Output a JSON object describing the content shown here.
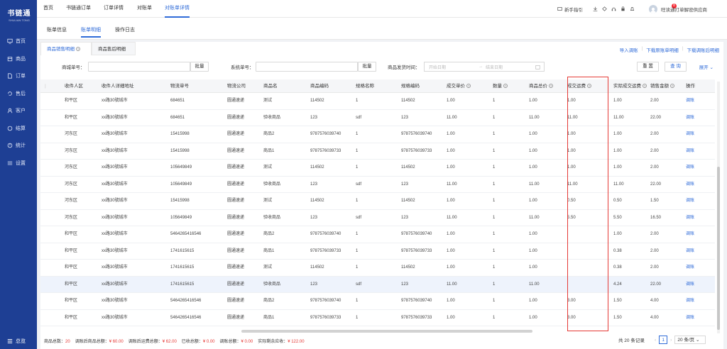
{
  "sidebar": {
    "logo_title": "书链通",
    "logo_sub": "SHULIAN TONG",
    "items": [
      {
        "label": "首页",
        "icon": "monitor-icon"
      },
      {
        "label": "商品",
        "icon": "box-icon"
      },
      {
        "label": "订单",
        "icon": "document-icon"
      },
      {
        "label": "售后",
        "icon": "aftersale-icon"
      },
      {
        "label": "客户",
        "icon": "user-icon"
      },
      {
        "label": "结算",
        "icon": "settlement-icon"
      },
      {
        "label": "统计",
        "icon": "chart-icon"
      },
      {
        "label": "设置",
        "icon": "settings-icon"
      }
    ],
    "bottom_label": "总览"
  },
  "topbar": {
    "tabs": [
      "首页",
      "书链通订单",
      "订单详情",
      "对账单",
      "对账单详情"
    ],
    "guide": "新手指引",
    "notification_count": "8",
    "user": "旺读通打单解密供应商"
  },
  "subtabs": [
    "账单信息",
    "账单明细",
    "操作日志"
  ],
  "panel": {
    "tabs": [
      "商品销售明细",
      "商品售后明细"
    ],
    "links": [
      "导入调账",
      "下载原账单明细",
      "下载调账后明细"
    ],
    "filters": {
      "order_label": "商城单号：",
      "batch": "批量",
      "system_label": "系统单号：",
      "ship_label": "商品发货时间：",
      "start_ph": "开始日期",
      "end_ph": "结束日期",
      "reset": "重 置",
      "query": "查 询",
      "expand": "展开"
    }
  },
  "table": {
    "columns": [
      "收件人区",
      "收件人详细地址",
      "物流单号",
      "物流公司",
      "商品名",
      "商品编码",
      "规格名称",
      "规格编码",
      "成交单价",
      "数量",
      "商品总价",
      "成交运费",
      "实际成交运费",
      "销售金额",
      "操作"
    ],
    "rows": [
      [
        "和平区",
        "xx路30號城市",
        "684651",
        "圆通速递",
        "测试",
        "114502",
        "1",
        "114502",
        "1.00",
        "1",
        "1.00",
        "1.00",
        "1.00",
        "2.00",
        "调账"
      ],
      [
        "和平区",
        "xx路30號城市",
        "684651",
        "圆通速递",
        "验收商品",
        "123",
        "sdf",
        "123",
        "11.00",
        "1",
        "11.00",
        "11.00",
        "11.00",
        "22.00",
        "调账"
      ],
      [
        "河东区",
        "xx路30號城市",
        "15415998",
        "圆通速递",
        "商品2",
        "9787576039740",
        "1",
        "9787576039740",
        "1.00",
        "1",
        "1.00",
        "1.00",
        "1.00",
        "2.00",
        "调账"
      ],
      [
        "河东区",
        "xx路30號城市",
        "15415998",
        "圆通速递",
        "商品1",
        "9787576039733",
        "1",
        "9787576039733",
        "1.00",
        "1",
        "1.00",
        "1.00",
        "1.00",
        "2.00",
        "调账"
      ],
      [
        "河东区",
        "xx路30號城市",
        "105649849",
        "圆通速递",
        "测试",
        "114502",
        "1",
        "114502",
        "1.00",
        "1",
        "1.00",
        "1.00",
        "1.00",
        "2.00",
        "调账"
      ],
      [
        "河东区",
        "xx路30號城市",
        "105649849",
        "圆通速递",
        "验收商品",
        "123",
        "sdf",
        "123",
        "11.00",
        "1",
        "11.00",
        "11.00",
        "11.00",
        "22.00",
        "调账"
      ],
      [
        "河东区",
        "xx路30號城市",
        "15415998",
        "圆通速递",
        "测试",
        "114502",
        "1",
        "114502",
        "1.00",
        "1",
        "1.00",
        "0.50",
        "0.50",
        "1.50",
        "调账"
      ],
      [
        "河东区",
        "xx路30號城市",
        "105649849",
        "圆通速递",
        "验收商品",
        "123",
        "sdf",
        "123",
        "11.00",
        "1",
        "11.00",
        "5.50",
        "5.50",
        "16.50",
        "调账"
      ],
      [
        "和平区",
        "xx路30號城市",
        "5464265416546",
        "圆通速递",
        "商品2",
        "9787576039740",
        "1",
        "9787576039740",
        "1.00",
        "1",
        "1.00",
        "",
        "1.00",
        "2.00",
        "调账"
      ],
      [
        "和平区",
        "xx路30號城市",
        "1741615615",
        "圆通速递",
        "商品1",
        "9787576039733",
        "1",
        "9787576039733",
        "1.00",
        "1",
        "1.00",
        "",
        "0.38",
        "2.00",
        "调账"
      ],
      [
        "和平区",
        "xx路30號城市",
        "1741615615",
        "圆通速递",
        "测试",
        "114502",
        "1",
        "114502",
        "1.00",
        "1",
        "1.00",
        "",
        "0.38",
        "2.00",
        "调账"
      ],
      [
        "和平区",
        "xx路30號城市",
        "1741615615",
        "圆通速递",
        "验收商品",
        "123",
        "sdf",
        "123",
        "11.00",
        "1",
        "11.00",
        "",
        "4.24",
        "22.00",
        "调账"
      ],
      [
        "和平区",
        "xx路30號城市",
        "5464265416546",
        "圆通速递",
        "商品2",
        "9787576039740",
        "1",
        "9787576039740",
        "1.00",
        "1",
        "1.00",
        "3.00",
        "1.50",
        "4.00",
        "调账"
      ],
      [
        "和平区",
        "xx路30號城市",
        "5464265416546",
        "圆通速递",
        "商品1",
        "9787576039733",
        "1",
        "9787576039733",
        "1.00",
        "1",
        "1.00",
        "3.00",
        "1.50",
        "4.00",
        "调账"
      ]
    ],
    "highlighted_row": 11
  },
  "footer": {
    "items": [
      {
        "label": "商品总数：",
        "value": "20"
      },
      {
        "label": "调账后商品总额：",
        "value": "¥ 60.00"
      },
      {
        "label": "调账后运费总额：",
        "value": "¥ 62.00"
      },
      {
        "label": "已收总额：",
        "value": "¥ 0.00"
      },
      {
        "label": "调账总额：",
        "value": "¥ 0.00"
      },
      {
        "label": "实际剩余应收：",
        "value": "¥ 122.00"
      }
    ],
    "total": "共 20 条记录",
    "page": "1",
    "page_size": "20 条/页"
  },
  "colors": {
    "sidebar": "#1e3f94",
    "accent": "#2f6bd8",
    "highlight_box": "#e53935"
  }
}
